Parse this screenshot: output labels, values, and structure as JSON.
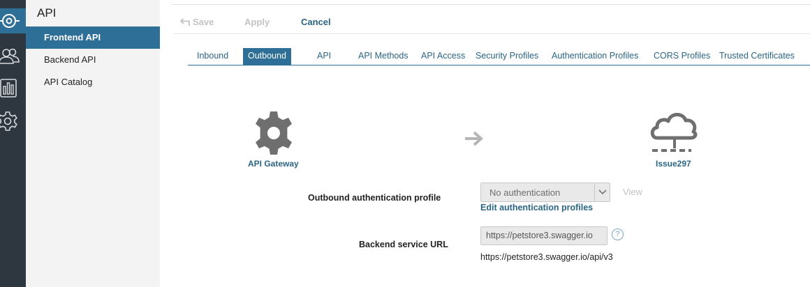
{
  "rail": {
    "icons": [
      "network-icon",
      "users-icon",
      "monitoring-icon",
      "settings-icon"
    ]
  },
  "nav": {
    "title": "API",
    "items": [
      {
        "label": "Frontend API",
        "active": true
      },
      {
        "label": "Backend API",
        "active": false
      },
      {
        "label": "API Catalog",
        "active": false
      }
    ]
  },
  "toolbar": {
    "save_label": "Save",
    "apply_label": "Apply",
    "cancel_label": "Cancel"
  },
  "tabs": [
    {
      "label": "Inbound",
      "active": false
    },
    {
      "label": "Outbound",
      "active": true
    },
    {
      "label": "API",
      "active": false
    },
    {
      "label": "API Methods",
      "active": false
    },
    {
      "label": "API Access",
      "active": false
    },
    {
      "label": "Security Profiles",
      "active": false
    },
    {
      "label": "Authentication Profiles",
      "active": false
    },
    {
      "label": "CORS Profiles",
      "active": false
    },
    {
      "label": "Trusted Certificates",
      "active": false
    }
  ],
  "diagram": {
    "source_label": "API Gateway",
    "target_label": "Issue297"
  },
  "form": {
    "auth_profile_label": "Outbound authentication profile",
    "auth_profile_value": "No authentication",
    "view_label": "View",
    "edit_auth_link": "Edit authentication profiles",
    "backend_url_label": "Backend service URL",
    "backend_url_value": "https://petstore3.swagger.io",
    "help_label": "?",
    "resolved_url": "https://petstore3.swagger.io/api/v3"
  },
  "colors": {
    "accent": "#2e6f97",
    "link": "#2b6585",
    "rail": "#2e3640",
    "disabled": "#c3c3c3"
  }
}
